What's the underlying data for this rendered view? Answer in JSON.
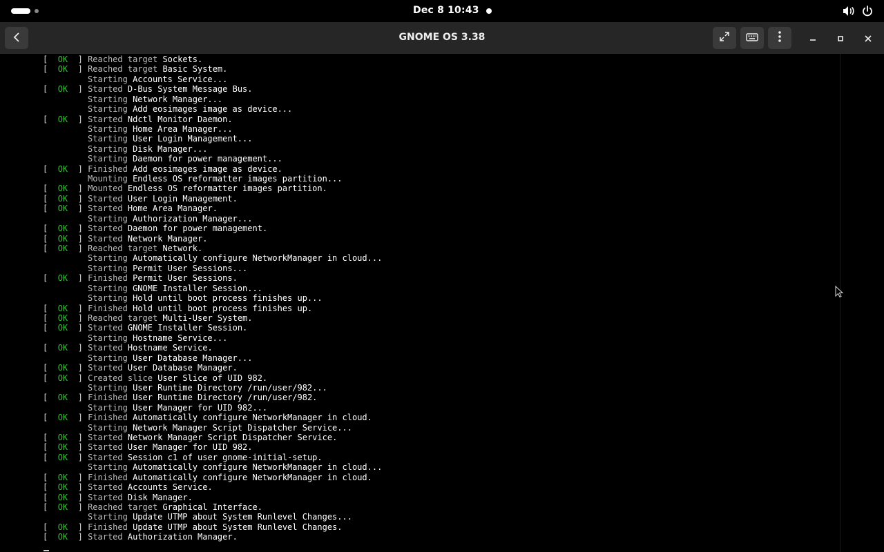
{
  "topbar": {
    "clock": "Dec 8  10:43",
    "icons": [
      "activities-indicator",
      "notification-dot",
      "volume-icon",
      "power-icon"
    ]
  },
  "window": {
    "title": "GNOME OS 3.38",
    "buttons": [
      "back-button",
      "fullscreen-button",
      "keyboard-button",
      "menu-button",
      "minimize-button",
      "maximize-button",
      "close-button"
    ]
  },
  "colors": {
    "ok": "#2fc42f",
    "headerbar": "#262626",
    "background": "#000000"
  },
  "log": [
    {
      "ok": true,
      "verb": "Reached target",
      "target": "Sockets."
    },
    {
      "ok": true,
      "verb": "Reached target",
      "target": "Basic System."
    },
    {
      "ok": false,
      "verb": "Starting",
      "target": "Accounts Service..."
    },
    {
      "ok": true,
      "verb": "Started",
      "target": "D-Bus System Message Bus."
    },
    {
      "ok": false,
      "verb": "Starting",
      "target": "Network Manager..."
    },
    {
      "ok": false,
      "verb": "Starting",
      "target": "Add eosimages image as device..."
    },
    {
      "ok": true,
      "verb": "Started",
      "target": "Ndctl Monitor Daemon."
    },
    {
      "ok": false,
      "verb": "Starting",
      "target": "Home Area Manager..."
    },
    {
      "ok": false,
      "verb": "Starting",
      "target": "User Login Management..."
    },
    {
      "ok": false,
      "verb": "Starting",
      "target": "Disk Manager..."
    },
    {
      "ok": false,
      "verb": "Starting",
      "target": "Daemon for power management..."
    },
    {
      "ok": true,
      "verb": "Finished",
      "target": "Add eosimages image as device."
    },
    {
      "ok": false,
      "verb": "Mounting",
      "target": "Endless OS reformatter images partition..."
    },
    {
      "ok": true,
      "verb": "Mounted",
      "target": "Endless OS reformatter images partition."
    },
    {
      "ok": true,
      "verb": "Started",
      "target": "User Login Management."
    },
    {
      "ok": true,
      "verb": "Started",
      "target": "Home Area Manager."
    },
    {
      "ok": false,
      "verb": "Starting",
      "target": "Authorization Manager..."
    },
    {
      "ok": true,
      "verb": "Started",
      "target": "Daemon for power management."
    },
    {
      "ok": true,
      "verb": "Started",
      "target": "Network Manager."
    },
    {
      "ok": true,
      "verb": "Reached target",
      "target": "Network."
    },
    {
      "ok": false,
      "verb": "Starting",
      "target": "Automatically configure NetworkManager in cloud..."
    },
    {
      "ok": false,
      "verb": "Starting",
      "target": "Permit User Sessions..."
    },
    {
      "ok": true,
      "verb": "Finished",
      "target": "Permit User Sessions."
    },
    {
      "ok": false,
      "verb": "Starting",
      "target": "GNOME Installer Session..."
    },
    {
      "ok": false,
      "verb": "Starting",
      "target": "Hold until boot process finishes up..."
    },
    {
      "ok": true,
      "verb": "Finished",
      "target": "Hold until boot process finishes up."
    },
    {
      "ok": true,
      "verb": "Reached target",
      "target": "Multi-User System."
    },
    {
      "ok": true,
      "verb": "Started",
      "target": "GNOME Installer Session."
    },
    {
      "ok": false,
      "verb": "Starting",
      "target": "Hostname Service..."
    },
    {
      "ok": true,
      "verb": "Started",
      "target": "Hostname Service."
    },
    {
      "ok": false,
      "verb": "Starting",
      "target": "User Database Manager..."
    },
    {
      "ok": true,
      "verb": "Started",
      "target": "User Database Manager."
    },
    {
      "ok": true,
      "verb": "Created slice",
      "target": "User Slice of UID 982."
    },
    {
      "ok": false,
      "verb": "Starting",
      "target": "User Runtime Directory /run/user/982..."
    },
    {
      "ok": true,
      "verb": "Finished",
      "target": "User Runtime Directory /run/user/982."
    },
    {
      "ok": false,
      "verb": "Starting",
      "target": "User Manager for UID 982..."
    },
    {
      "ok": true,
      "verb": "Finished",
      "target": "Automatically configure NetworkManager in cloud."
    },
    {
      "ok": false,
      "verb": "Starting",
      "target": "Network Manager Script Dispatcher Service..."
    },
    {
      "ok": true,
      "verb": "Started",
      "target": "Network Manager Script Dispatcher Service."
    },
    {
      "ok": true,
      "verb": "Started",
      "target": "User Manager for UID 982."
    },
    {
      "ok": true,
      "verb": "Started",
      "target": "Session c1 of user gnome-initial-setup."
    },
    {
      "ok": false,
      "verb": "Starting",
      "target": "Automatically configure NetworkManager in cloud..."
    },
    {
      "ok": true,
      "verb": "Finished",
      "target": "Automatically configure NetworkManager in cloud."
    },
    {
      "ok": true,
      "verb": "Started",
      "target": "Accounts Service."
    },
    {
      "ok": true,
      "verb": "Started",
      "target": "Disk Manager."
    },
    {
      "ok": true,
      "verb": "Reached target",
      "target": "Graphical Interface."
    },
    {
      "ok": false,
      "verb": "Starting",
      "target": "Update UTMP about System Runlevel Changes..."
    },
    {
      "ok": true,
      "verb": "Finished",
      "target": "Update UTMP about System Runlevel Changes."
    },
    {
      "ok": true,
      "verb": "Started",
      "target": "Authorization Manager."
    }
  ],
  "labels": {
    "ok_open": "[  ",
    "ok_text": "OK",
    "ok_close": "  ]",
    "indent": "        "
  }
}
